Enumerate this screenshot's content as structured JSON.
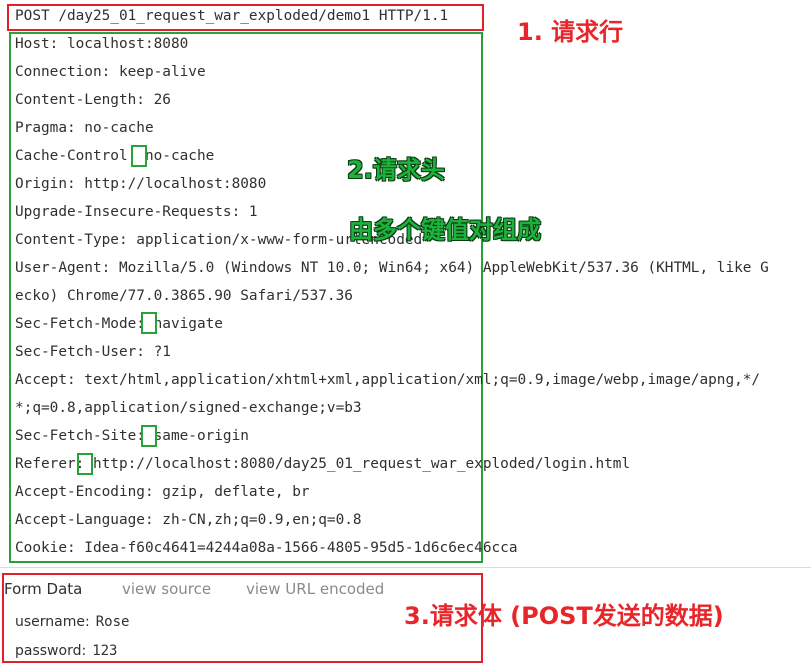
{
  "request_line": "POST /day25_01_request_war_exploded/demo1 HTTP/1.1",
  "headers": [
    "Host: localhost:8080",
    "Connection: keep-alive",
    "Content-Length: 26",
    "Pragma: no-cache",
    "Cache-Control: no-cache",
    "Origin: http://localhost:8080",
    "Upgrade-Insecure-Requests: 1",
    "Content-Type: application/x-www-form-urlencoded",
    "User-Agent: Mozilla/5.0 (Windows NT 10.0; Win64; x64) AppleWebKit/537.36 (KHTML, like G",
    "ecko) Chrome/77.0.3865.90 Safari/537.36",
    "Sec-Fetch-Mode: navigate",
    "Sec-Fetch-User: ?1",
    "Accept: text/html,application/xhtml+xml,application/xml;q=0.9,image/webp,image/apng,*/",
    "*;q=0.8,application/signed-exchange;v=b3",
    "Sec-Fetch-Site: same-origin",
    "Referer: http://localhost:8080/day25_01_request_war_exploded/login.html",
    "Accept-Encoding: gzip, deflate, br",
    "Accept-Language: zh-CN,zh;q=0.9,en;q=0.8",
    "Cookie: Idea-f60c4641=4244a08a-1566-4805-95d5-1d6c6ec46cca"
  ],
  "form_data": {
    "title": "Form Data",
    "view_source": "view source",
    "view_url_encoded": "view URL encoded",
    "fields": [
      {
        "key": "username:",
        "value": "Rose"
      },
      {
        "key": "password:",
        "value": "123"
      }
    ]
  },
  "annotations": {
    "request_line_label": "1. 请求行",
    "headers_label": "2.请求头",
    "headers_desc": "由多个键值对组成",
    "body_label": "3.请求体 (POST发送的数据)"
  },
  "colors": {
    "red_box": "#e0202a",
    "green_box": "#2aa23a",
    "red_text": "#e8262a",
    "green_text": "#1db23c",
    "link_gray": "#8a8a8a"
  }
}
